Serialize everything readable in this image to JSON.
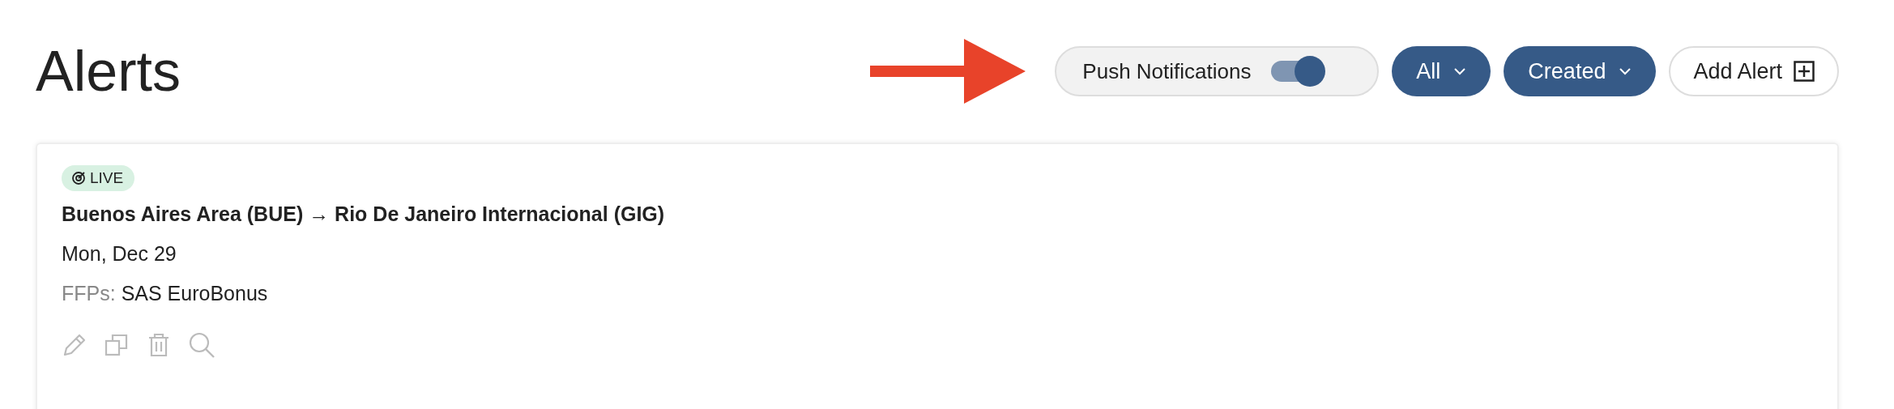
{
  "title": "Alerts",
  "push_notifications": {
    "label": "Push Notifications",
    "on": true
  },
  "filters": [
    {
      "label": "All"
    },
    {
      "label": "Created"
    }
  ],
  "add_button": {
    "label": "Add Alert"
  },
  "alerts": [
    {
      "status": "LIVE",
      "route": "Buenos Aires Area (BUE) → Rio De Janeiro Internacional (GIG)",
      "date": "Mon, Dec 29",
      "ffp_label": "FFPs:",
      "ffp_value": "SAS EuroBonus"
    }
  ]
}
